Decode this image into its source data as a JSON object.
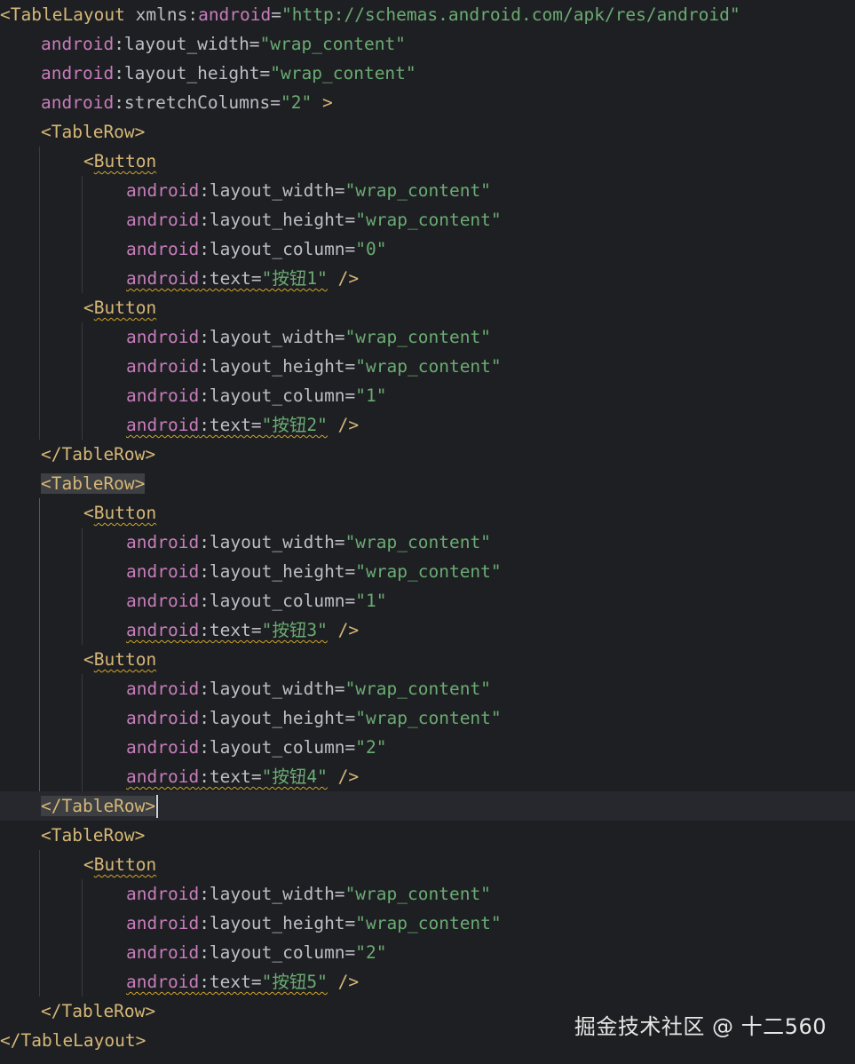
{
  "editor": {
    "lines": [
      [
        {
          "t": "tag",
          "v": "<TableLayout "
        },
        {
          "t": "attr",
          "v": "xmlns"
        },
        {
          "t": "plain",
          "v": ":"
        },
        {
          "t": "ns",
          "v": "android"
        },
        {
          "t": "plain",
          "v": "="
        },
        {
          "t": "val",
          "v": "\"http://schemas.android.com/apk/res/android\""
        }
      ],
      [
        {
          "t": "ns",
          "v": "android"
        },
        {
          "t": "plain",
          "v": ":layout_width="
        },
        {
          "t": "val",
          "v": "\"wrap_content\""
        }
      ],
      [
        {
          "t": "ns",
          "v": "android"
        },
        {
          "t": "plain",
          "v": ":layout_height="
        },
        {
          "t": "val",
          "v": "\"wrap_content\""
        }
      ],
      [
        {
          "t": "ns",
          "v": "android"
        },
        {
          "t": "plain",
          "v": ":stretchColumns="
        },
        {
          "t": "val",
          "v": "\"2\""
        },
        {
          "t": "tag",
          "v": " >"
        }
      ],
      [
        {
          "t": "tag",
          "v": "<TableRow>"
        }
      ],
      [
        {
          "t": "tag",
          "v": "<"
        },
        {
          "t": "tag-wavy",
          "v": "Button"
        }
      ],
      [
        {
          "t": "ns",
          "v": "android"
        },
        {
          "t": "plain",
          "v": ":layout_width="
        },
        {
          "t": "val",
          "v": "\"wrap_content\""
        }
      ],
      [
        {
          "t": "ns",
          "v": "android"
        },
        {
          "t": "plain",
          "v": ":layout_height="
        },
        {
          "t": "val",
          "v": "\"wrap_content\""
        }
      ],
      [
        {
          "t": "ns",
          "v": "android"
        },
        {
          "t": "plain",
          "v": ":layout_column="
        },
        {
          "t": "val",
          "v": "\"0\""
        }
      ],
      [
        {
          "t": "ns-wavy",
          "v": "android"
        },
        {
          "t": "plain-wavy",
          "v": ":text="
        },
        {
          "t": "val-wavy",
          "v": "\"按钮1\""
        },
        {
          "t": "tag",
          "v": " />"
        }
      ],
      [
        {
          "t": "tag",
          "v": "<"
        },
        {
          "t": "tag-wavy",
          "v": "Button"
        }
      ],
      [
        {
          "t": "ns",
          "v": "android"
        },
        {
          "t": "plain",
          "v": ":layout_width="
        },
        {
          "t": "val",
          "v": "\"wrap_content\""
        }
      ],
      [
        {
          "t": "ns",
          "v": "android"
        },
        {
          "t": "plain",
          "v": ":layout_height="
        },
        {
          "t": "val",
          "v": "\"wrap_content\""
        }
      ],
      [
        {
          "t": "ns",
          "v": "android"
        },
        {
          "t": "plain",
          "v": ":layout_column="
        },
        {
          "t": "val",
          "v": "\"1\""
        }
      ],
      [
        {
          "t": "ns-wavy",
          "v": "android"
        },
        {
          "t": "plain-wavy",
          "v": ":text="
        },
        {
          "t": "val-wavy",
          "v": "\"按钮2\""
        },
        {
          "t": "tag",
          "v": " />"
        }
      ],
      [
        {
          "t": "tag",
          "v": "</TableRow>"
        }
      ],
      [
        {
          "t": "tag-hl",
          "v": "<TableRow>"
        }
      ],
      [
        {
          "t": "tag",
          "v": "<"
        },
        {
          "t": "tag-wavy",
          "v": "Button"
        }
      ],
      [
        {
          "t": "ns",
          "v": "android"
        },
        {
          "t": "plain",
          "v": ":layout_width="
        },
        {
          "t": "val",
          "v": "\"wrap_content\""
        }
      ],
      [
        {
          "t": "ns",
          "v": "android"
        },
        {
          "t": "plain",
          "v": ":layout_height="
        },
        {
          "t": "val",
          "v": "\"wrap_content\""
        }
      ],
      [
        {
          "t": "ns",
          "v": "android"
        },
        {
          "t": "plain",
          "v": ":layout_column="
        },
        {
          "t": "val",
          "v": "\"1\""
        }
      ],
      [
        {
          "t": "ns-wavy",
          "v": "android"
        },
        {
          "t": "plain-wavy",
          "v": ":text="
        },
        {
          "t": "val-wavy",
          "v": "\"按钮3\""
        },
        {
          "t": "tag",
          "v": " />"
        }
      ],
      [
        {
          "t": "tag",
          "v": "<"
        },
        {
          "t": "tag-wavy",
          "v": "Button"
        }
      ],
      [
        {
          "t": "ns",
          "v": "android"
        },
        {
          "t": "plain",
          "v": ":layout_width="
        },
        {
          "t": "val",
          "v": "\"wrap_content\""
        }
      ],
      [
        {
          "t": "ns",
          "v": "android"
        },
        {
          "t": "plain",
          "v": ":layout_height="
        },
        {
          "t": "val",
          "v": "\"wrap_content\""
        }
      ],
      [
        {
          "t": "ns",
          "v": "android"
        },
        {
          "t": "plain",
          "v": ":layout_column="
        },
        {
          "t": "val",
          "v": "\"2\""
        }
      ],
      [
        {
          "t": "ns-wavy",
          "v": "android"
        },
        {
          "t": "plain-wavy",
          "v": ":text="
        },
        {
          "t": "val-wavy",
          "v": "\"按钮4\""
        },
        {
          "t": "tag",
          "v": " />"
        }
      ],
      [
        {
          "t": "tag-hl",
          "v": "</TableRow>"
        }
      ],
      [
        {
          "t": "tag",
          "v": "<TableRow>"
        }
      ],
      [
        {
          "t": "tag",
          "v": "<"
        },
        {
          "t": "tag-wavy",
          "v": "Button"
        }
      ],
      [
        {
          "t": "ns",
          "v": "android"
        },
        {
          "t": "plain",
          "v": ":layout_width="
        },
        {
          "t": "val",
          "v": "\"wrap_content\""
        }
      ],
      [
        {
          "t": "ns",
          "v": "android"
        },
        {
          "t": "plain",
          "v": ":layout_height="
        },
        {
          "t": "val",
          "v": "\"wrap_content\""
        }
      ],
      [
        {
          "t": "ns",
          "v": "android"
        },
        {
          "t": "plain",
          "v": ":layout_column="
        },
        {
          "t": "val",
          "v": "\"2\""
        }
      ],
      [
        {
          "t": "ns-wavy",
          "v": "android"
        },
        {
          "t": "plain-wavy",
          "v": ":text="
        },
        {
          "t": "val-wavy",
          "v": "\"按钮5\""
        },
        {
          "t": "tag",
          "v": " />"
        }
      ],
      [
        {
          "t": "tag",
          "v": "</TableRow>"
        }
      ],
      [
        {
          "t": "tag",
          "v": "</TableLayout>"
        }
      ]
    ],
    "current_line": 27
  },
  "watermark": "掘金技术社区 @ 十二560",
  "colors": {
    "background": "#1e1f22",
    "tag": "#d5b778",
    "namespace": "#c77dbb",
    "attribute": "#bcbec4",
    "string": "#6aab73",
    "warning_underline": "#d0a52a"
  }
}
